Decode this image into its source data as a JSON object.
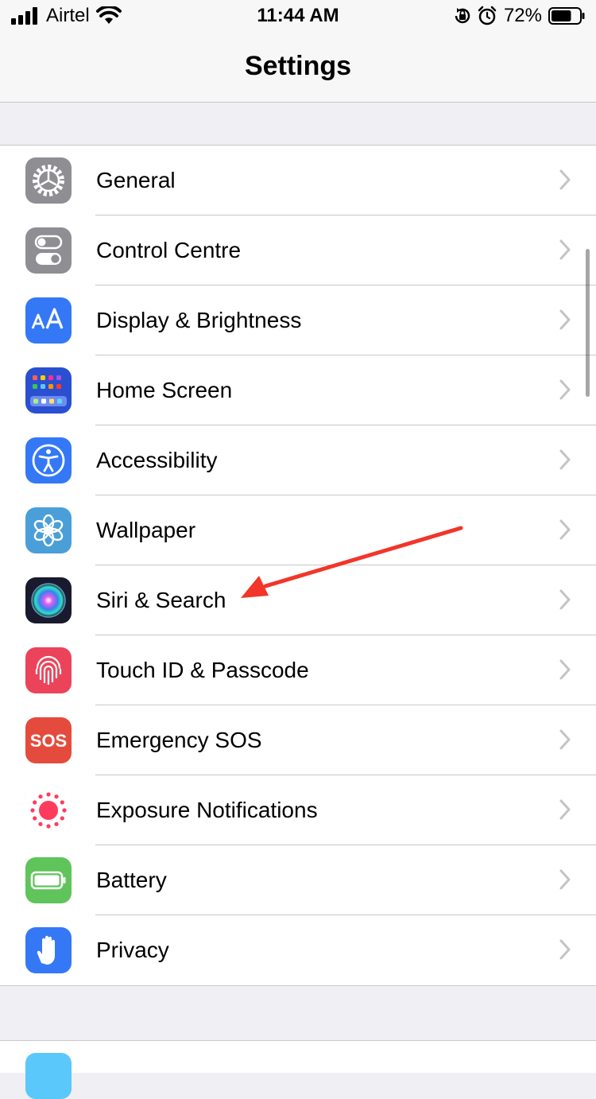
{
  "status_bar": {
    "carrier": "Airtel",
    "time": "11:44 AM",
    "battery_percent": "72%",
    "battery_level": 0.72
  },
  "nav": {
    "title": "Settings"
  },
  "settings": {
    "items": [
      {
        "label": "General",
        "icon": "gear-icon",
        "color": "#8e8e93"
      },
      {
        "label": "Control Centre",
        "icon": "toggles-icon",
        "color": "#8e8e93"
      },
      {
        "label": "Display & Brightness",
        "icon": "text-size-icon",
        "color": "#3478f6"
      },
      {
        "label": "Home Screen",
        "icon": "home-grid-icon",
        "color": "#2a4fd0"
      },
      {
        "label": "Accessibility",
        "icon": "accessibility-icon",
        "color": "#3478f6"
      },
      {
        "label": "Wallpaper",
        "icon": "flower-icon",
        "color": "#4a9fd8"
      },
      {
        "label": "Siri & Search",
        "icon": "siri-icon",
        "color": "#1a1a2e"
      },
      {
        "label": "Touch ID & Passcode",
        "icon": "fingerprint-icon",
        "color": "#eb445a"
      },
      {
        "label": "Emergency SOS",
        "icon": "sos-icon",
        "color": "#e54b3c"
      },
      {
        "label": "Exposure Notifications",
        "icon": "exposure-icon",
        "color": "#ffffff"
      },
      {
        "label": "Battery",
        "icon": "battery-icon",
        "color": "#5fc45a"
      },
      {
        "label": "Privacy",
        "icon": "hand-icon",
        "color": "#3478f6"
      }
    ]
  },
  "sos_text": "SOS",
  "annotation": {
    "arrow_color": "#f2352a"
  }
}
